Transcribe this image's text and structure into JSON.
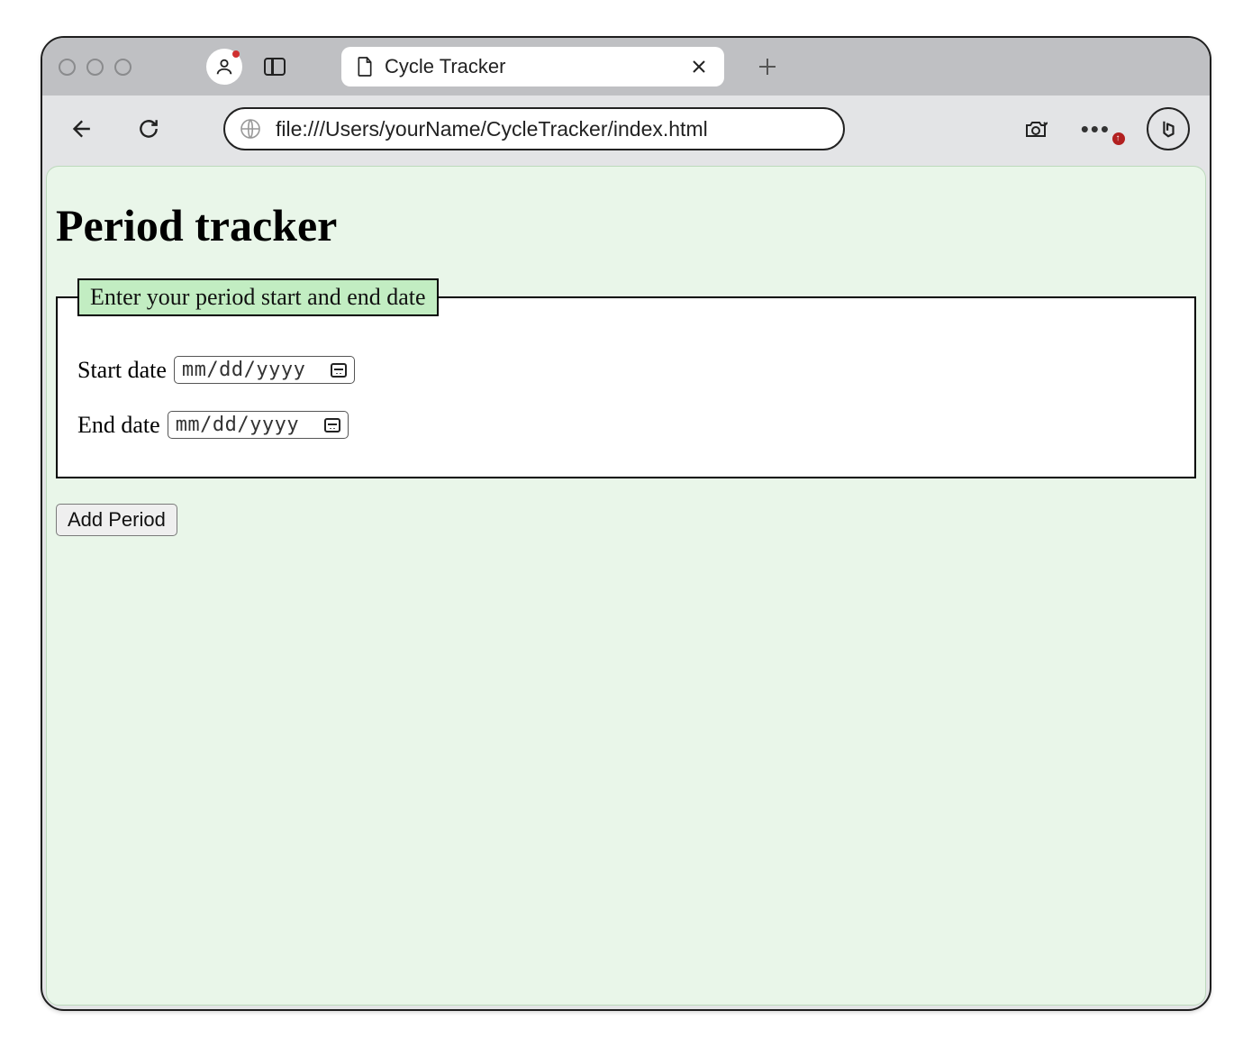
{
  "browser": {
    "tab_title": "Cycle Tracker",
    "url": "file:///Users/yourName/CycleTracker/index.html"
  },
  "page": {
    "heading": "Period tracker",
    "fieldset_legend": "Enter your period start and end date",
    "start_label": "Start date",
    "end_label": "End date",
    "date_placeholder": "mm/dd/yyyy",
    "submit_label": "Add Period"
  }
}
